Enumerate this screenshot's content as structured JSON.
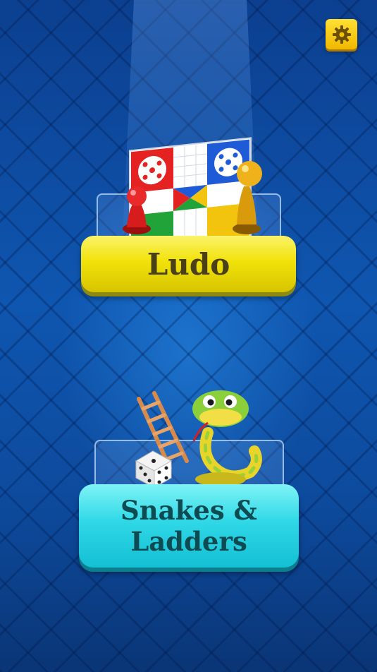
{
  "games": {
    "ludo_label": "Ludo",
    "snakes_line1": "Snakes &",
    "snakes_line2": "Ladders"
  },
  "icons": {
    "settings": "gear-icon",
    "ludo_art": "ludo-board-icon",
    "snakes_art": "snake-ladder-dice-icon"
  },
  "colors": {
    "background": "#0f56b0",
    "settings_button": "#f5c400",
    "ludo_button": "#f2e20a",
    "snakes_button": "#2fd8e6"
  }
}
